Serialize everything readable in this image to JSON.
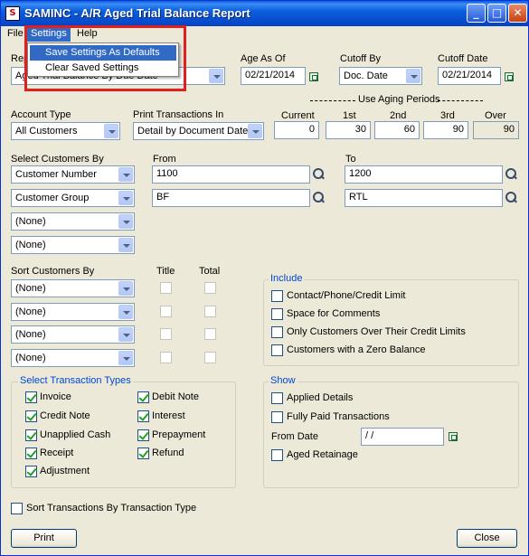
{
  "window": {
    "title": "SAMINC - A/R Aged Trial Balance Report",
    "icon": "sage-app-icon"
  },
  "titlebar_buttons": {
    "minimize": "_",
    "maximize": "□",
    "close": "✕"
  },
  "menu": {
    "file": "File",
    "settings": "Settings",
    "help": "Help",
    "settings_items": [
      "Save Settings As Defaults",
      "Clear Saved Settings"
    ]
  },
  "report": {
    "label": "Report",
    "value": "Aged Trial Balance By Due Date"
  },
  "age_as_of": {
    "label": "Age As Of",
    "value": "02/21/2014"
  },
  "cutoff_by": {
    "label": "Cutoff By",
    "value": "Doc. Date"
  },
  "cutoff_date": {
    "label": "Cutoff Date",
    "value": "02/21/2014"
  },
  "aging": {
    "title": "Use Aging Periods",
    "headers": [
      "Current",
      "1st",
      "2nd",
      "3rd",
      "Over"
    ],
    "values": [
      "0",
      "30",
      "60",
      "90",
      "90"
    ]
  },
  "account_type": {
    "label": "Account Type",
    "value": "All Customers"
  },
  "print_transactions": {
    "label": "Print Transactions In",
    "value": "Detail by Document Date"
  },
  "select_customers": {
    "label": "Select Customers By",
    "from_label": "From",
    "to_label": "To",
    "rows": [
      {
        "by": "Customer Number",
        "from": "1100",
        "to": "1200"
      },
      {
        "by": "Customer Group",
        "from": "BF",
        "to": "RTL"
      },
      {
        "by": "(None)"
      },
      {
        "by": "(None)"
      }
    ]
  },
  "sort_customers": {
    "label": "Sort Customers By",
    "title_col": "Title",
    "total_col": "Total",
    "rows": [
      "(None)",
      "(None)",
      "(None)",
      "(None)"
    ]
  },
  "include": {
    "title": "Include",
    "items": [
      {
        "label": "Contact/Phone/Credit Limit",
        "checked": false
      },
      {
        "label": "Space for Comments",
        "checked": false
      },
      {
        "label": "Only Customers Over Their Credit Limits",
        "checked": false
      },
      {
        "label": "Customers with a Zero Balance",
        "checked": false
      }
    ]
  },
  "transaction_types": {
    "title": "Select Transaction Types",
    "items": [
      {
        "label": "Invoice",
        "checked": true
      },
      {
        "label": "Debit Note",
        "checked": true
      },
      {
        "label": "Credit Note",
        "checked": true
      },
      {
        "label": "Interest",
        "checked": true
      },
      {
        "label": "Unapplied Cash",
        "checked": true
      },
      {
        "label": "Prepayment",
        "checked": true
      },
      {
        "label": "Receipt",
        "checked": true
      },
      {
        "label": "Refund",
        "checked": true
      },
      {
        "label": "Adjustment",
        "checked": true
      }
    ]
  },
  "show": {
    "title": "Show",
    "applied_details": "Applied Details",
    "fully_paid": "Fully Paid Transactions",
    "from_date_label": "From Date",
    "from_date_value": "/ /",
    "aged_retainage": "Aged Retainage"
  },
  "sort_by_type": {
    "label": "Sort Transactions By Transaction Type",
    "checked": false
  },
  "buttons": {
    "print": "Print",
    "close": "Close"
  },
  "colors": {
    "titlebar": "#0a5fdc",
    "highlight": "#316ac5",
    "group_title": "#0046d5",
    "callout": "#e02020"
  }
}
